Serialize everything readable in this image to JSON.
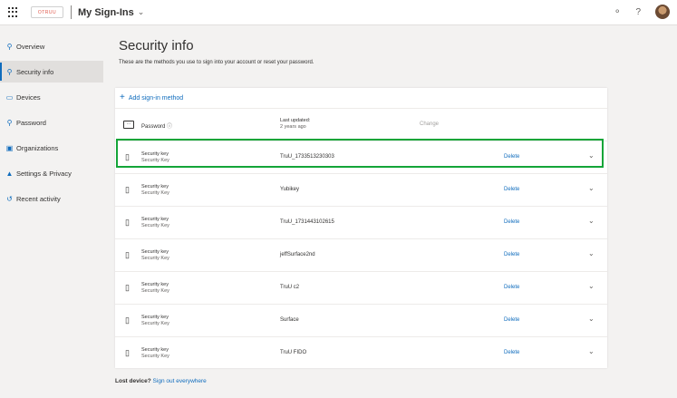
{
  "header": {
    "org_logo_text": "OTRUU",
    "app_title": "My Sign-Ins",
    "title_dropdown_icon": "chevron-down-icon",
    "icons": [
      "waffle-icon",
      "organization-icon",
      "help-icon",
      "avatar"
    ]
  },
  "sidebar": {
    "items": [
      {
        "label": "Overview",
        "icon": "person-icon",
        "active": false
      },
      {
        "label": "Security info",
        "icon": "person-key-icon",
        "active": true
      },
      {
        "label": "Devices",
        "icon": "laptop-icon",
        "active": false
      },
      {
        "label": "Password",
        "icon": "key-icon",
        "active": false
      },
      {
        "label": "Organizations",
        "icon": "briefcase-icon",
        "active": false
      },
      {
        "label": "Settings & Privacy",
        "icon": "lock-icon",
        "active": false
      },
      {
        "label": "Recent activity",
        "icon": "history-icon",
        "active": false
      }
    ]
  },
  "main": {
    "title": "Security info",
    "description": "These are the methods you use to sign into your account or reset your password.",
    "add_method_label": "Add sign-in method",
    "password_row": {
      "label": "Password",
      "last_updated_label": "Last updated:",
      "last_updated_value": "2 years ago",
      "change_label": "Change"
    },
    "methods": [
      {
        "type": "Security key",
        "subtype": "Security Key",
        "detail": "TruU_1733513230303",
        "action": "Delete",
        "highlighted": true
      },
      {
        "type": "Security key",
        "subtype": "Security Key",
        "detail": "Yubikey",
        "action": "Delete",
        "highlighted": false
      },
      {
        "type": "Security key",
        "subtype": "Security Key",
        "detail": "TruU_1731443102615",
        "action": "Delete",
        "highlighted": false
      },
      {
        "type": "Security key",
        "subtype": "Security Key",
        "detail": "jeffSurface2nd",
        "action": "Delete",
        "highlighted": false
      },
      {
        "type": "Security key",
        "subtype": "Security Key",
        "detail": "TruU c2",
        "action": "Delete",
        "highlighted": false
      },
      {
        "type": "Security key",
        "subtype": "Security Key",
        "detail": "Surface",
        "action": "Delete",
        "highlighted": false
      },
      {
        "type": "Security key",
        "subtype": "Security Key",
        "detail": "TruU FIDO",
        "action": "Delete",
        "highlighted": false
      }
    ],
    "lost_device": {
      "question": "Lost device?",
      "link": "Sign out everywhere"
    }
  },
  "colors": {
    "accent": "#0f6cbd",
    "highlight": "#13a538",
    "background": "#f3f2f1"
  }
}
